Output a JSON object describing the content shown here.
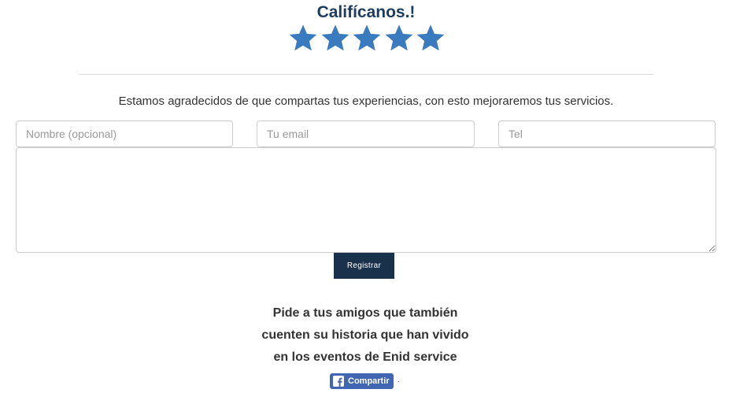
{
  "rating": {
    "title": "Califícanos.!",
    "stars": 5,
    "star_color": "#3a7bbf",
    "star_icon": "star-icon"
  },
  "intro_text": "Estamos agradecidos de que compartas tus experiencias, con esto mejoraremos tus servicios.",
  "form": {
    "name_placeholder": "Nombre (opcional)",
    "email_placeholder": "Tu email",
    "tel_placeholder": "Tel",
    "message_value": "",
    "submit_label": "Registrar",
    "submit_color": "#1a314b"
  },
  "invite": {
    "line1": "Pide a tus amigos que también",
    "line2": "cuenten su historia que han vivido",
    "line3": "en los eventos de Enid service"
  },
  "share": {
    "label": "Compartir",
    "icon": "facebook-icon",
    "color": "#4267b2",
    "separator": "·"
  }
}
